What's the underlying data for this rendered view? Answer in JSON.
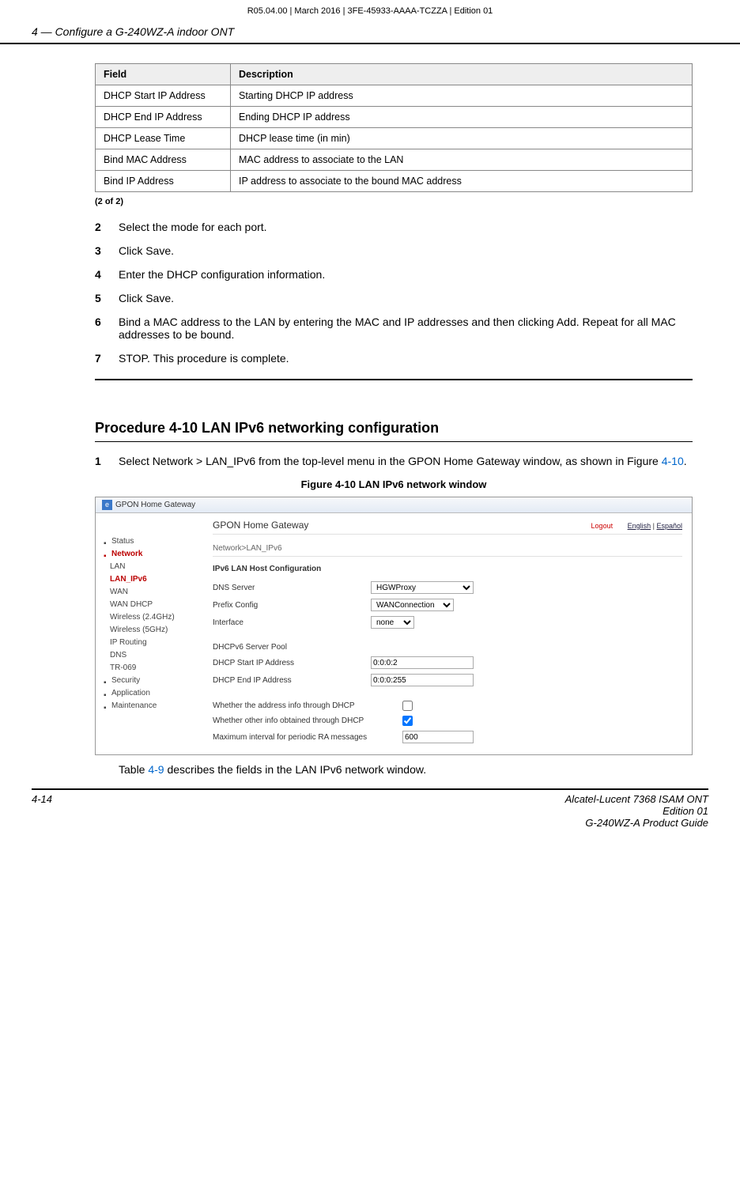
{
  "header_line": "R05.04.00 | March 2016 | 3FE-45933-AAAA-TCZZA | Edition 01",
  "section_header": "4 —  Configure a G-240WZ-A indoor ONT",
  "table": {
    "col_field": "Field",
    "col_desc": "Description",
    "rows": [
      {
        "field": "DHCP Start IP Address",
        "desc": "Starting DHCP IP address"
      },
      {
        "field": "DHCP End IP Address",
        "desc": "Ending DHCP IP address"
      },
      {
        "field": "DHCP Lease Time",
        "desc": "DHCP lease time (in min)"
      },
      {
        "field": "Bind MAC Address",
        "desc": "MAC address to associate to the LAN"
      },
      {
        "field": "Bind IP Address",
        "desc": "IP address to associate to the bound MAC address"
      }
    ]
  },
  "page_note": "(2 of 2)",
  "steps_a": [
    {
      "n": "2",
      "t": "Select the mode for each port."
    },
    {
      "n": "3",
      "t": "Click Save."
    },
    {
      "n": "4",
      "t": "Enter the DHCP configuration information."
    },
    {
      "n": "5",
      "t": "Click Save."
    },
    {
      "n": "6",
      "t": "Bind a MAC address to the LAN by entering the MAC and IP addresses and then clicking Add. Repeat for all MAC addresses to be bound."
    },
    {
      "n": "7",
      "t": "STOP. This procedure is complete."
    }
  ],
  "proc_heading": "Procedure 4-10  LAN IPv6 networking configuration",
  "step1": {
    "n": "1",
    "pre": "Select Network > LAN_IPv6 from the top-level menu in the GPON Home Gateway window, as shown in Figure ",
    "link": "4-10",
    "post": "."
  },
  "fig_caption": "Figure 4-10  LAN IPv6 network window",
  "screenshot": {
    "tab_title": "GPON Home Gateway",
    "main_title": "GPON Home Gateway",
    "logout": "Logout",
    "lang1": "English",
    "lang2": "Español",
    "breadcrumb": "Network>LAN_IPv6",
    "sidebar": {
      "status": "Status",
      "network": "Network",
      "items": [
        "LAN",
        "LAN_IPv6",
        "WAN",
        "WAN DHCP",
        "Wireless (2.4GHz)",
        "Wireless (5GHz)",
        "IP Routing",
        "DNS",
        "TR-069"
      ],
      "security": "Security",
      "application": "Application",
      "maintenance": "Maintenance"
    },
    "form": {
      "section": "IPv6 LAN Host Configuration",
      "dns_server_lbl": "DNS Server",
      "dns_server_val": "HGWProxy",
      "prefix_lbl": "Prefix Config",
      "prefix_val": "WANConnection",
      "interface_lbl": "Interface",
      "interface_val": "none",
      "pool_lbl": "DHCPv6 Server Pool",
      "start_lbl": "DHCP Start IP Address",
      "start_val": "0:0:0:2",
      "end_lbl": "DHCP End IP Address",
      "end_val": "0:0:0:255",
      "addr_dhcp_lbl": "Whether the address info through DHCP",
      "other_dhcp_lbl": "Whether other info obtained through DHCP",
      "max_ra_lbl": "Maximum interval for periodic RA messages",
      "max_ra_val": "600"
    }
  },
  "after_fig_pre": "Table ",
  "after_fig_link": "4-9",
  "after_fig_post": " describes the fields in the LAN IPv6 network window.",
  "footer": {
    "page": "4-14",
    "r1": "Alcatel-Lucent 7368 ISAM ONT",
    "r2": "Edition 01",
    "r3": "G-240WZ-A Product Guide"
  }
}
